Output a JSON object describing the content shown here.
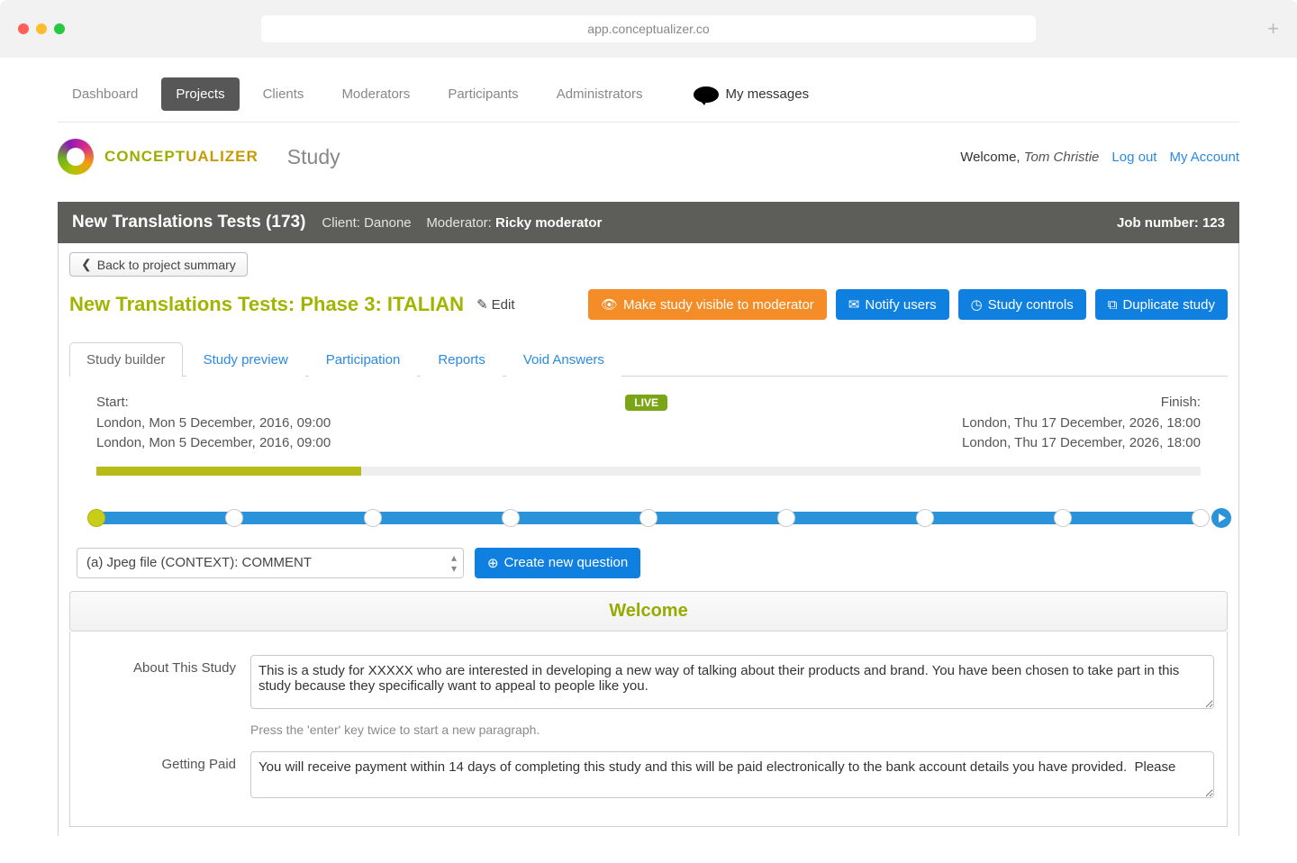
{
  "browser": {
    "url": "app.conceptualizer.co"
  },
  "nav": {
    "items": [
      "Dashboard",
      "Projects",
      "Clients",
      "Moderators",
      "Participants",
      "Administrators"
    ],
    "active_index": 1,
    "my_messages": "My messages"
  },
  "brand": {
    "name_part1": "CONCEPT",
    "name_part2": "UALIZER",
    "section": "Study"
  },
  "user": {
    "welcome_prefix": "Welcome, ",
    "name": "Tom Christie",
    "logout": "Log out",
    "my_account": "My Account"
  },
  "darkbar": {
    "title": "New Translations Tests (173)",
    "client_label": "Client: ",
    "client": "Danone",
    "moderator_label": "Moderator: ",
    "moderator": "Ricky moderator",
    "job_label": "Job number: ",
    "job_number": "123"
  },
  "back_button": "Back to project summary",
  "study": {
    "title": "New Translations Tests: Phase 3: ITALIAN",
    "edit": "Edit"
  },
  "actions": {
    "visible": "Make study visible to moderator",
    "notify": "Notify users",
    "controls": "Study controls",
    "duplicate": "Duplicate study"
  },
  "tabs": [
    "Study builder",
    "Study preview",
    "Participation",
    "Reports",
    "Void Answers"
  ],
  "active_tab_index": 0,
  "timeline": {
    "start_label": "Start:",
    "start_lines": [
      "London, Mon 5 December, 2016, 09:00",
      "London, Mon 5 December, 2016, 09:00"
    ],
    "finish_label": "Finish:",
    "finish_lines": [
      "London, Thu 17 December, 2026, 18:00",
      "London, Thu 17 December, 2026, 18:00"
    ],
    "live_badge": "LIVE",
    "progress_percent": 24,
    "step_count": 9,
    "active_step": 0
  },
  "question_select": {
    "selected": "(a) Jpeg file (CONTEXT): COMMENT",
    "create_label": "Create new question"
  },
  "welcome": {
    "heading": "Welcome",
    "about_label": "About This Study",
    "about_value": "This is a study for XXXXX who are interested in developing a new way of talking about their products and brand. You have been chosen to take part in this study because they specifically want to appeal to people like you.",
    "about_hint": "Press the 'enter' key twice to start a new paragraph.",
    "paid_label": "Getting Paid",
    "paid_value": "You will receive payment within 14 days of completing this study and this will be paid electronically to the bank account details you have provided.  Please"
  }
}
